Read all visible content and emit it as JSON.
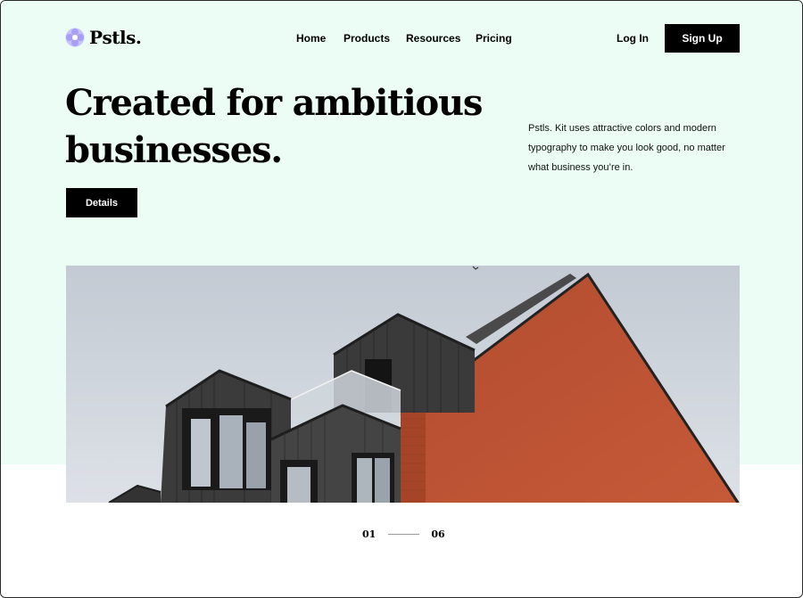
{
  "brand": {
    "name": "Pstls.",
    "logo_icon": "pastel-flower-logo-icon",
    "accent": "#a79ef5"
  },
  "nav": {
    "items": [
      {
        "label": "Home"
      },
      {
        "label": "Products"
      },
      {
        "label": "Resources"
      },
      {
        "label": "Pricing"
      }
    ]
  },
  "auth": {
    "login_label": "Log In",
    "signup_label": "Sign Up"
  },
  "hero": {
    "headline_line1": "Created for ambitious",
    "headline_line2": "businesses.",
    "cta_label": "Details",
    "description": "Pstls. Kit uses attractive colors and modern typography to make you look good, no matter what business you’re in.",
    "background": "#ebfdf4",
    "image_alt": "modern-building-photo"
  },
  "pager": {
    "current": "01",
    "total": "06"
  }
}
